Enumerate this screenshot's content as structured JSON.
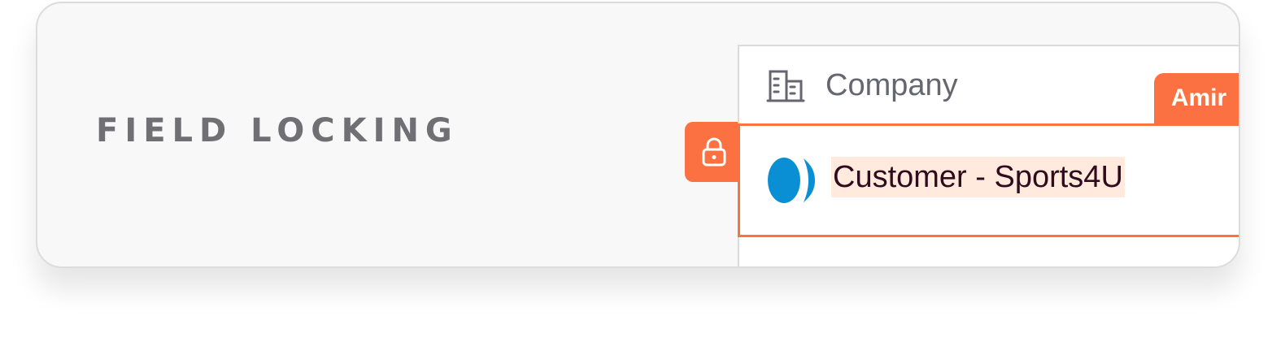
{
  "feature": {
    "title": "FIELD LOCKING"
  },
  "field": {
    "label": "Company",
    "label_icon": "building-icon",
    "locked_by": "Amir",
    "value": "Customer - Sports4U",
    "value_icon": "organization-logo-icon",
    "lock_icon": "lock-icon"
  },
  "colors": {
    "accent": "#fb7141",
    "title_text": "#6f6f74",
    "value_highlight": "#ffeadd",
    "value_text": "#2f0b1d",
    "logo_blue": "#0a8fd4"
  }
}
